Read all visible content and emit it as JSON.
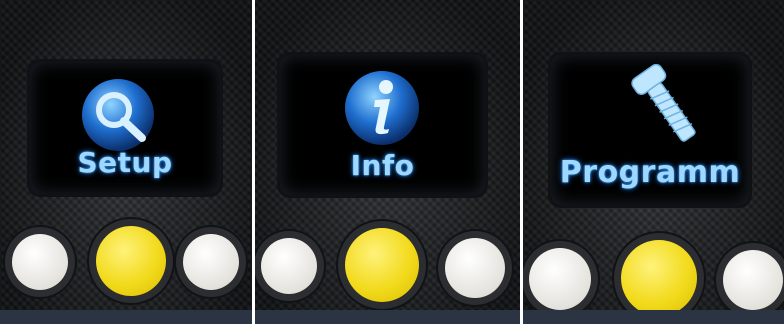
{
  "panels": [
    {
      "label": "Setup",
      "icon": "magnifier-icon"
    },
    {
      "label": "Info",
      "icon": "info-icon"
    },
    {
      "label": "Programm",
      "icon": "screw-icon"
    }
  ],
  "colors": {
    "screen_text": "#9fd8ff",
    "icon_blue": "#1f6fd0",
    "button_yellow": "#f2da1c",
    "button_white": "#ece9e2",
    "carbon_background": "#1b1d20"
  }
}
